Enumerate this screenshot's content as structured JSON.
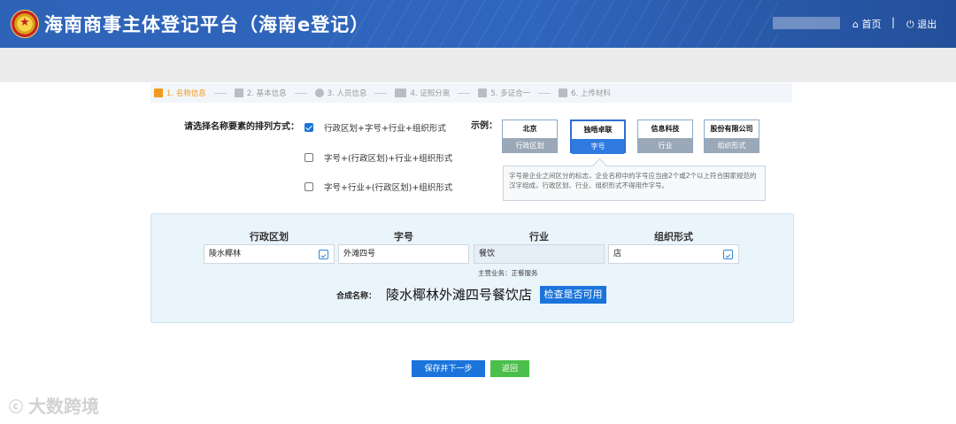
{
  "header": {
    "title": "海南商事主体登记平台（海南e登记）",
    "home": "首页",
    "separator": "|",
    "logout": "退出",
    "home_icon": "home-icon",
    "logout_icon": "power-icon"
  },
  "steps": [
    {
      "label": "1. 名称信息",
      "icon": "bar-chart-icon",
      "active": true
    },
    {
      "label": "2. 基本信息",
      "icon": "bar-chart-icon",
      "active": false
    },
    {
      "label": "3. 人员信息",
      "icon": "person-icon",
      "active": false
    },
    {
      "label": "4. 证照分离",
      "icon": "cards-icon",
      "active": false
    },
    {
      "label": "5. 多证合一",
      "icon": "document-icon",
      "active": false
    },
    {
      "label": "6. 上传材料",
      "icon": "upload-icon",
      "active": false
    }
  ],
  "arrangement": {
    "label": "请选择名称要素的排列方式：",
    "options": [
      {
        "text": "行政区划+字号+行业+组织形式",
        "checked": true
      },
      {
        "text": "字号+(行政区划)+行业+组织形式",
        "checked": false
      },
      {
        "text": "字号+行业+(行政区划)+组织形式",
        "checked": false
      }
    ]
  },
  "example": {
    "label": "示例：",
    "cards": [
      {
        "top": "北京",
        "bottom": "行政区划",
        "active": false
      },
      {
        "top": "独唔卓联",
        "bottom": "字号",
        "active": true
      },
      {
        "top": "信息科技",
        "bottom": "行业",
        "active": false
      },
      {
        "top": "股份有限公司",
        "bottom": "组织形式",
        "active": false
      }
    ],
    "tip": "字号是企业之间区分的标志，企业名称中的字号应当由2个或2个以上符合国家规范的汉字组成，行政区划、行业、组织形式不得用作字号。"
  },
  "name_form": {
    "columns": [
      "行政区划",
      "字号",
      "行业",
      "组织形式"
    ],
    "values": [
      "陵水椰林",
      "外滩四号",
      "餐饮",
      "店"
    ],
    "business_note": "主营业务：正餐服务",
    "combined_label": "合成名称：",
    "combined_value": "陵水椰林外滩四号餐饮店",
    "check_button": "检查是否可用"
  },
  "actions": {
    "save_next": "保存并下一步",
    "back": "返回"
  },
  "watermark": "大数跨境",
  "colors": {
    "header_blue": "#2f66bd",
    "primary_button": "#1a74dc",
    "back_button": "#4bbf4b",
    "active_step": "#f39a1e"
  }
}
